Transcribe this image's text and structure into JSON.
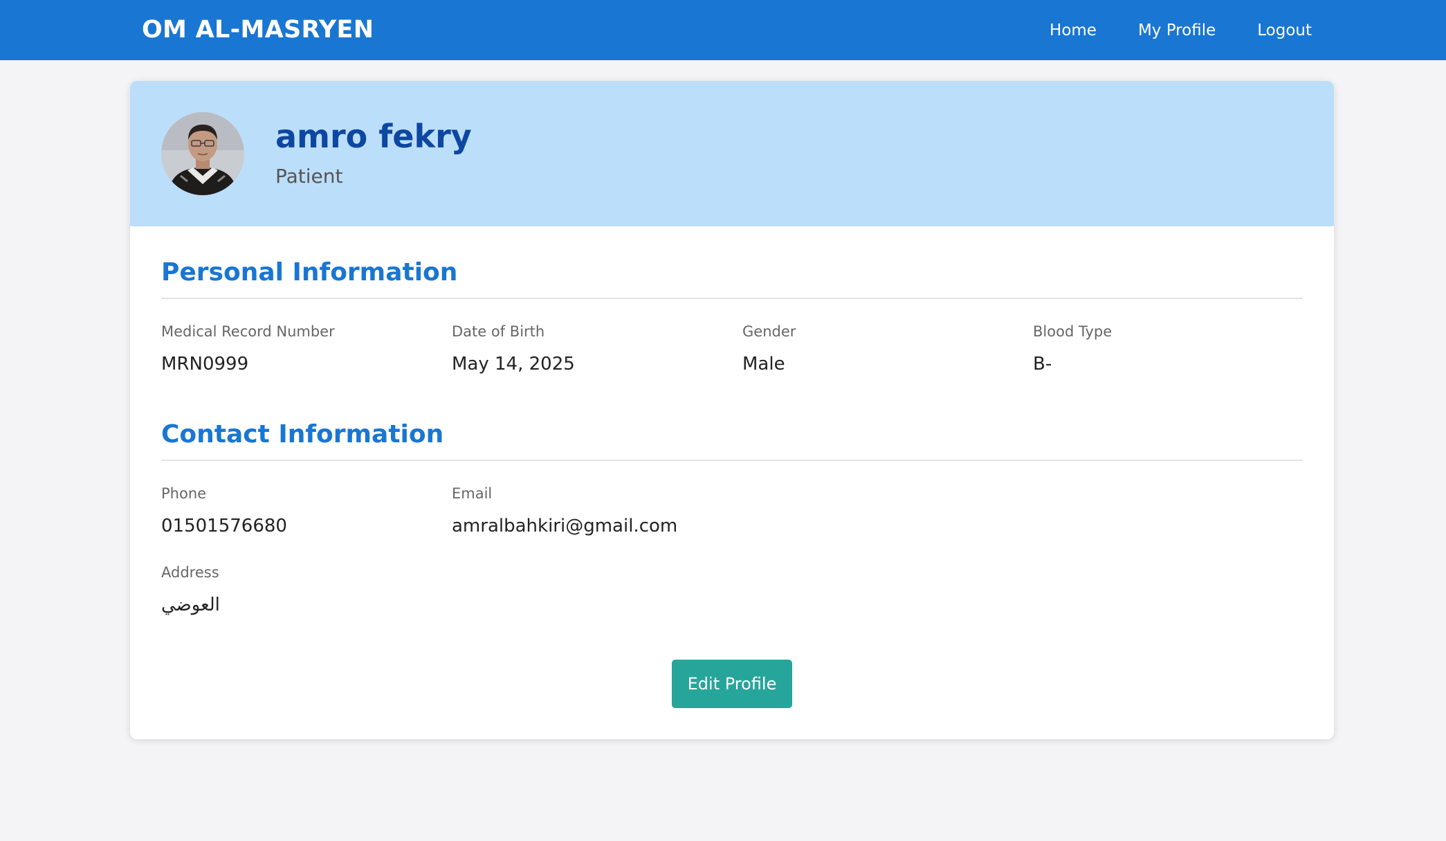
{
  "navbar": {
    "brand": "OM AL-MASRYEN",
    "links": [
      "Home",
      "My Profile",
      "Logout"
    ]
  },
  "profile": {
    "name": "amro fekry",
    "role": "Patient"
  },
  "personal_info": {
    "title": "Personal Information",
    "fields": [
      {
        "label": "Medical Record Number",
        "value": "MRN0999"
      },
      {
        "label": "Date of Birth",
        "value": "May 14, 2025"
      },
      {
        "label": "Gender",
        "value": "Male"
      },
      {
        "label": "Blood Type",
        "value": "B-"
      }
    ]
  },
  "contact_info": {
    "title": "Contact Information",
    "phone": {
      "label": "Phone",
      "value": "01501576680"
    },
    "email": {
      "label": "Email",
      "value": "amralbahkiri@gmail.com"
    },
    "address": {
      "label": "Address",
      "value": "العوضي"
    }
  },
  "actions": {
    "edit_label": "Edit Profile"
  },
  "colors": {
    "navbar": "#1976d2",
    "header_bg": "#bbdefb",
    "name": "#0d47a1",
    "section_title": "#1976d2",
    "button": "#26a69a"
  }
}
